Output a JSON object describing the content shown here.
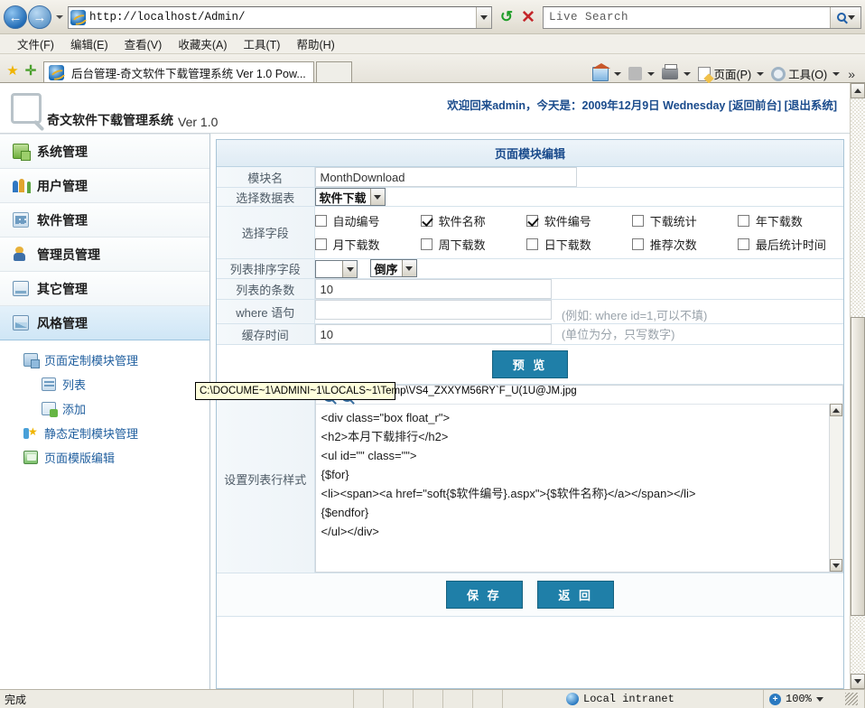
{
  "browser": {
    "address_url": "http://localhost/Admin/",
    "search_placeholder": "Live Search",
    "menu": [
      "文件(F)",
      "编辑(E)",
      "查看(V)",
      "收藏夹(A)",
      "工具(T)",
      "帮助(H)"
    ],
    "tab_title": "后台管理-奇文软件下载管理系统 Ver 1.0 Pow...",
    "toolbar": {
      "page_label": "页面(P)",
      "tools_label": "工具(O)",
      "overflow": "»"
    }
  },
  "app": {
    "logo_text": "奇文软件下载管理系统",
    "version": "Ver 1.0",
    "welcome_prefix": "欢迎回来admin，今天是：2009年12月9日 Wednesday",
    "link_front": "[返回前台]",
    "link_logout": "[退出系统]"
  },
  "sidebar": {
    "items": [
      {
        "label": "系统管理",
        "icon": "system-icon"
      },
      {
        "label": "用户管理",
        "icon": "users-icon"
      },
      {
        "label": "软件管理",
        "icon": "software-icon"
      },
      {
        "label": "管理员管理",
        "icon": "admin-icon"
      },
      {
        "label": "其它管理",
        "icon": "other-icon"
      },
      {
        "label": "风格管理",
        "icon": "style-icon"
      }
    ],
    "sub_items": [
      {
        "label": "页面定制模块管理",
        "icon": "module-icon",
        "level": 1
      },
      {
        "label": "列表",
        "icon": "list-icon",
        "level": 2
      },
      {
        "label": "添加",
        "icon": "add-icon",
        "level": 2
      },
      {
        "label": "静态定制模块管理",
        "icon": "static-module-icon",
        "level": 1
      },
      {
        "label": "页面模版编辑",
        "icon": "template-icon",
        "level": 1
      }
    ]
  },
  "panel": {
    "title": "页面模块编辑",
    "rows": {
      "module_name_label": "模块名",
      "module_name_value": "MonthDownload",
      "datatable_label": "选择数据表",
      "datatable_value": "软件下载",
      "fields_label": "选择字段",
      "sort_label": "列表排序字段",
      "sort_order_value": "倒序",
      "count_label": "列表的条数",
      "count_value": "10",
      "where_label": "where 语句",
      "where_value": "",
      "where_hint": "(例如: where id=1,可以不填)",
      "cache_label": "缓存时间",
      "cache_value": "10",
      "cache_hint": "(单位为分，只写数字)",
      "rowstyle_label": "设置列表行样式"
    },
    "fields": [
      {
        "label": "自动编号",
        "checked": false
      },
      {
        "label": "软件名称",
        "checked": true
      },
      {
        "label": "软件编号",
        "checked": true
      },
      {
        "label": "下载统计",
        "checked": false
      },
      {
        "label": "年下载数",
        "checked": false
      },
      {
        "label": "月下载数",
        "checked": false
      },
      {
        "label": "周下载数",
        "checked": false
      },
      {
        "label": "日下载数",
        "checked": false
      },
      {
        "label": "推荐次数",
        "checked": false
      },
      {
        "label": "最后统计时间",
        "checked": false
      }
    ],
    "preview_button": "预 览",
    "save_button": "保 存",
    "back_button": "返 回",
    "code": "<div class=\"box float_r\">\n<h2>本月下载排行</h2>\n<ul id=\"\" class=\"\">\n{$for}\n<li><span><a href=\"soft{$软件编号}.aspx\">{$软件名称}</a></span></li>\n{$endfor}\n</ul></div>"
  },
  "tooltip": {
    "text": "C:\\DOCUME~1\\ADMINI~1\\LOCALS~1\\Temp\\VS4_ZXXYM56RY`F_U(1U@JM.jpg"
  },
  "statusbar": {
    "status": "完成",
    "zone": "Local intranet",
    "zoom": "100%"
  },
  "colors": {
    "accent_blue": "#1f7fa8",
    "link_blue": "#1a4b8c",
    "sidebar_active": "#cfe6f6"
  }
}
